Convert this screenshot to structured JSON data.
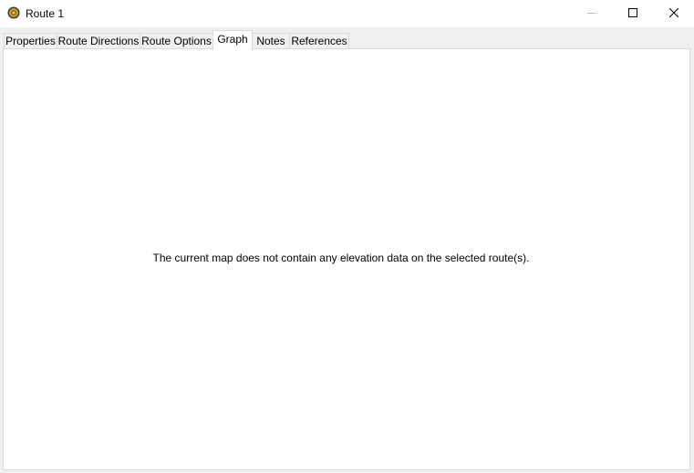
{
  "window": {
    "title": "Route 1",
    "app_icon": "compass-globe-icon",
    "controls": [
      "minimize-icon",
      "maximize-icon",
      "close-icon"
    ]
  },
  "tabs": [
    {
      "label": "Properties",
      "active": false
    },
    {
      "label": "Route Directions",
      "active": false
    },
    {
      "label": "Route Options",
      "active": false
    },
    {
      "label": "Graph",
      "active": true
    },
    {
      "label": "Notes",
      "active": false
    },
    {
      "label": "References",
      "active": false
    }
  ],
  "graph": {
    "message": "The current map does not contain any elevation data on the selected route(s)."
  },
  "colors": {
    "titlebar_bg": "#ffffff",
    "window_bg": "#f0f0f0",
    "panel_bg": "#ffffff",
    "border": "#d9d9d9",
    "icon_gold": "#c9a227",
    "icon_dark": "#3a3a3a"
  }
}
